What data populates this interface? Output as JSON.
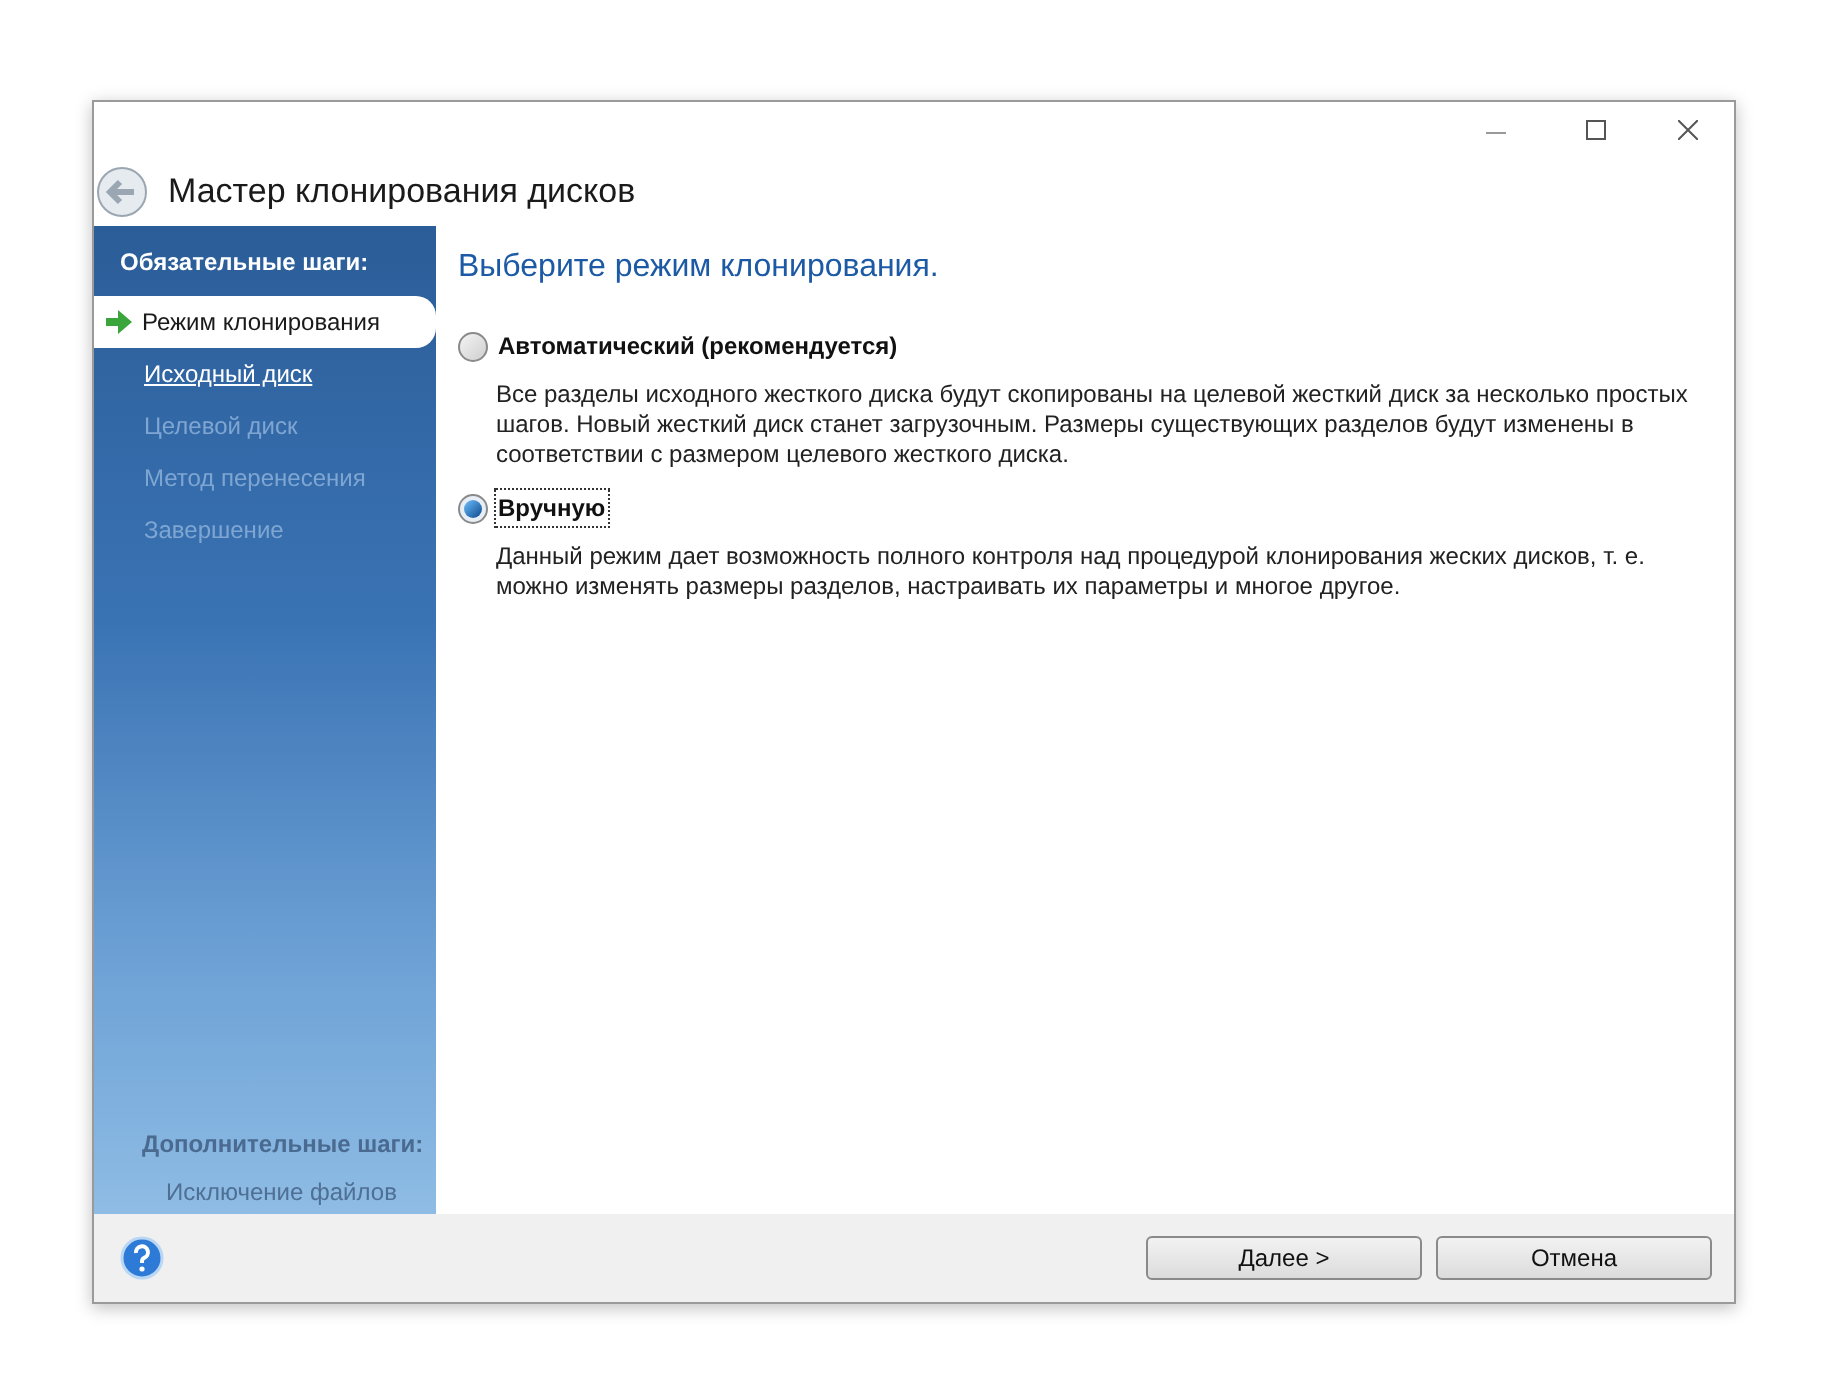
{
  "window": {
    "title": "Мастер клонирования дисков"
  },
  "sidebar": {
    "required_heading": "Обязательные шаги:",
    "items": [
      {
        "label": "Режим клонирования",
        "selected": true,
        "enabled": true
      },
      {
        "label": "Исходный диск",
        "selected": false,
        "enabled": true
      },
      {
        "label": "Целевой диск",
        "selected": false,
        "enabled": false
      },
      {
        "label": "Метод перенесения",
        "selected": false,
        "enabled": false
      },
      {
        "label": "Завершение",
        "selected": false,
        "enabled": false
      }
    ],
    "optional_heading": "Дополнительные шаги:",
    "optional_items": [
      {
        "label": "Исключение файлов",
        "enabled": false
      }
    ]
  },
  "content": {
    "heading": "Выберите режим клонирования.",
    "options": [
      {
        "label": "Автоматический (рекомендуется)",
        "description": "Все разделы исходного жесткого диска будут скопированы на целевой жесткий диск за несколько простых шагов. Новый жесткий диск станет загрузочным. Размеры существующих разделов будут изменены в соответствии с размером целевого жесткого диска.",
        "selected": false
      },
      {
        "label": "Вручную",
        "description": "Данный режим дает возможность полного контроля над процедурой клонирования жеских дисков, т. е. можно изменять размеры разделов, настраивать их параметры и многое другое.",
        "selected": true
      }
    ]
  },
  "buttons": [
    "Далее >",
    "Отмена"
  ]
}
